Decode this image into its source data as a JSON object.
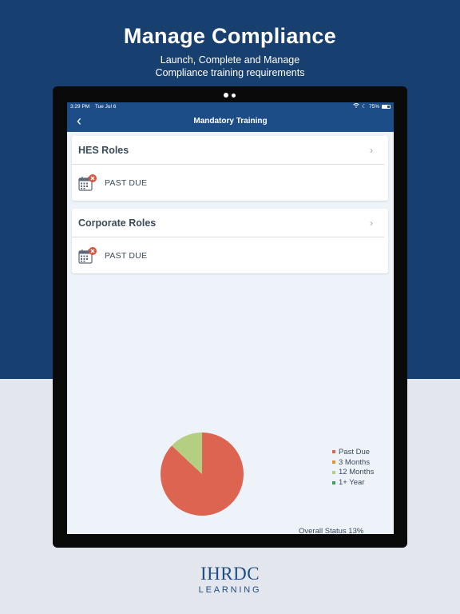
{
  "hero": {
    "title": "Manage Compliance",
    "subtitle_line1": "Launch, Complete and Manage",
    "subtitle_line2": "Compliance training requirements"
  },
  "statusbar": {
    "time": "3:29 PM",
    "date": "Tue Jul 6",
    "battery": "75%"
  },
  "navbar": {
    "back_icon": "chevron-left-icon",
    "title": "Mandatory Training"
  },
  "roles": [
    {
      "title": "HES Roles",
      "status": "PAST DUE"
    },
    {
      "title": "Corporate Roles",
      "status": "PAST DUE"
    }
  ],
  "chart_data": {
    "type": "pie",
    "slices": [
      {
        "label": "Past Due",
        "value": 87,
        "color": "#dc6450"
      },
      {
        "label": "3 Months",
        "value": 0,
        "color": "#e8902e"
      },
      {
        "label": "12 Months",
        "value": 13,
        "color": "#b5cf82"
      },
      {
        "label": "1+ Year",
        "value": 0,
        "color": "#3e9a55"
      }
    ],
    "legend_position": "right"
  },
  "overall_status": "Overall Status 13%",
  "logo": {
    "main": "IHRDC",
    "sub": "LEARNING"
  }
}
